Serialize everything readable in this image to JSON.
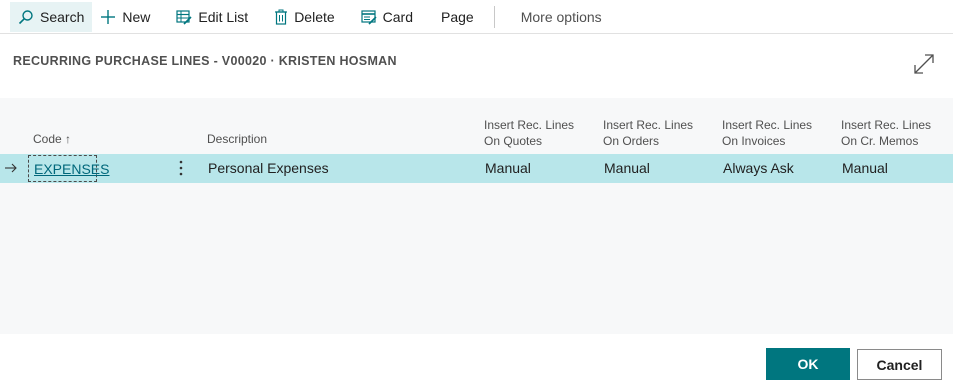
{
  "toolbar": {
    "search_label": "Search",
    "new_label": "New",
    "edit_list_label": "Edit List",
    "delete_label": "Delete",
    "card_label": "Card",
    "page_label": "Page",
    "more_options_label": "More options"
  },
  "page": {
    "title": "RECURRING PURCHASE LINES - V00020 · KRISTEN HOSMAN"
  },
  "grid": {
    "columns": {
      "code": "Code ↑",
      "description": "Description",
      "quotes_line1": "Insert Rec. Lines",
      "quotes_line2": "On Quotes",
      "orders_line1": "Insert Rec. Lines",
      "orders_line2": "On Orders",
      "invoices_line1": "Insert Rec. Lines",
      "invoices_line2": "On Invoices",
      "memos_line1": "Insert Rec. Lines",
      "memos_line2": "On Cr. Memos"
    },
    "rows": [
      {
        "code": "EXPENSES",
        "description": "Personal Expenses",
        "quotes": "Manual",
        "orders": "Manual",
        "invoices": "Always Ask",
        "memos": "Manual"
      }
    ]
  },
  "footer": {
    "ok_label": "OK",
    "cancel_label": "Cancel"
  },
  "colors": {
    "accent": "#00767f",
    "selected_row": "#b8e6ea",
    "link": "#00677b"
  }
}
